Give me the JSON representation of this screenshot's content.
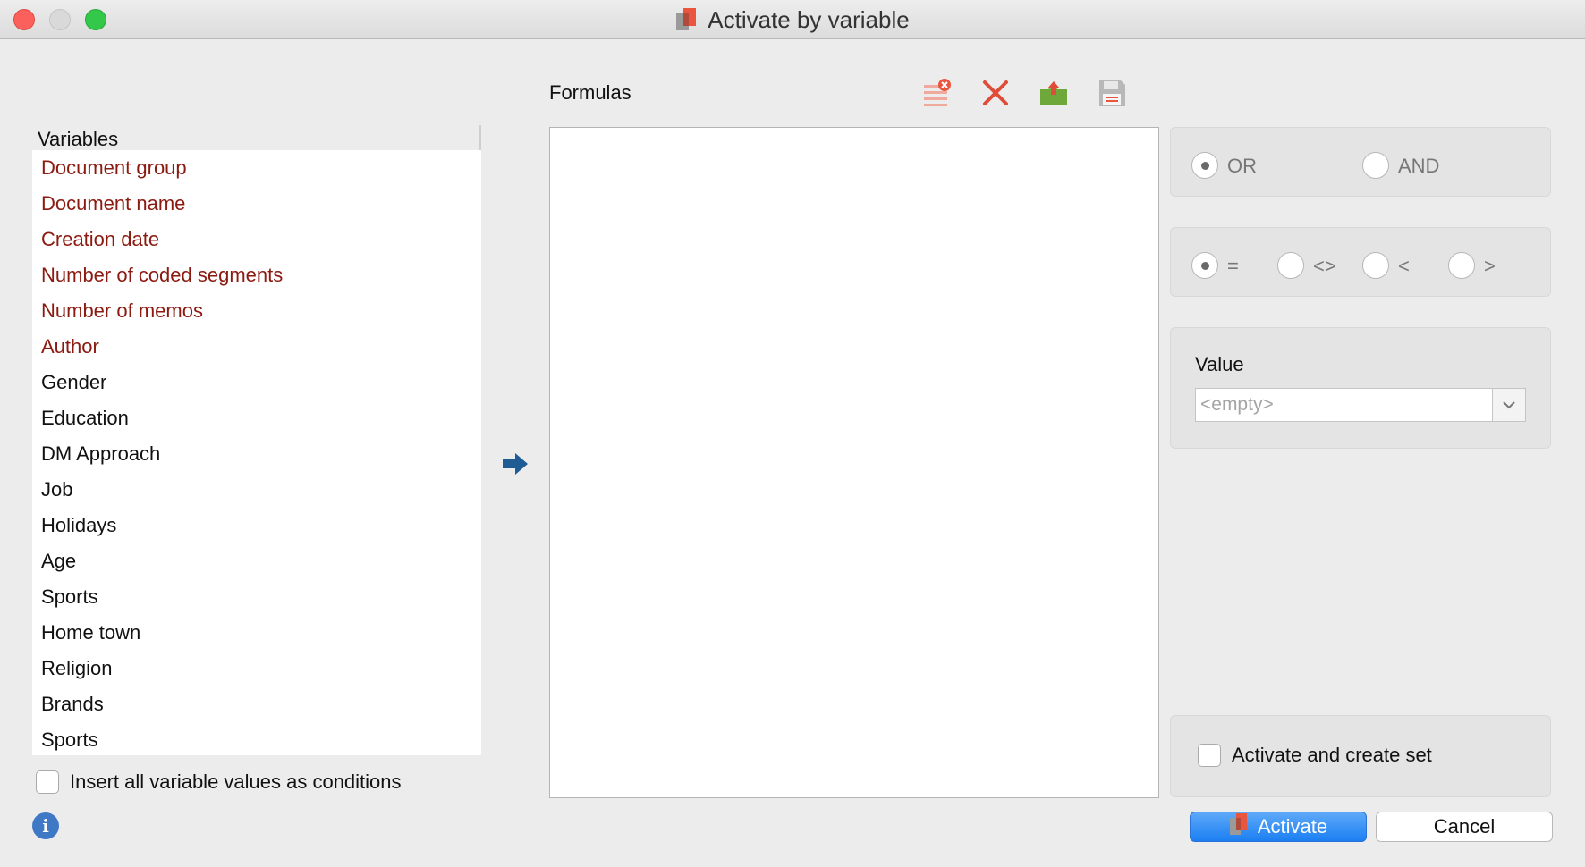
{
  "window": {
    "title": "Activate by variable",
    "title_icon": "maxqda-activate-icon"
  },
  "variables": {
    "header": "Variables",
    "items": [
      {
        "label": "Document group",
        "system": true
      },
      {
        "label": "Document name",
        "system": true
      },
      {
        "label": "Creation date",
        "system": true
      },
      {
        "label": "Number of coded segments",
        "system": true
      },
      {
        "label": "Number of memos",
        "system": true
      },
      {
        "label": "Author",
        "system": true
      },
      {
        "label": "Gender",
        "system": false
      },
      {
        "label": "Education",
        "system": false
      },
      {
        "label": "DM Approach",
        "system": false
      },
      {
        "label": "Job",
        "system": false
      },
      {
        "label": "Holidays",
        "system": false
      },
      {
        "label": "Age",
        "system": false
      },
      {
        "label": "Sports",
        "system": false
      },
      {
        "label": "Home town",
        "system": false
      },
      {
        "label": "Religion",
        "system": false
      },
      {
        "label": "Brands",
        "system": false
      },
      {
        "label": "Sports",
        "system": false
      }
    ],
    "insert_all_label": "Insert all variable values as conditions",
    "insert_all_checked": false
  },
  "formulas": {
    "label": "Formulas",
    "toolbar": [
      "clear-list-icon",
      "delete-icon",
      "open-icon",
      "save-icon"
    ]
  },
  "logic": {
    "options": [
      {
        "label": "OR",
        "selected": true
      },
      {
        "label": "AND",
        "selected": false
      }
    ]
  },
  "operators": {
    "options": [
      {
        "label": "=",
        "selected": true
      },
      {
        "label": "<>",
        "selected": false
      },
      {
        "label": "<",
        "selected": false
      },
      {
        "label": ">",
        "selected": false
      }
    ]
  },
  "value": {
    "label": "Value",
    "placeholder": "<empty>"
  },
  "activate_set": {
    "label": "Activate and create set",
    "checked": false
  },
  "buttons": {
    "activate": "Activate",
    "cancel": "Cancel"
  },
  "colors": {
    "system_variable": "#8b1a10",
    "activate_button": "#1b7ff2",
    "delete_red": "#e04c3a",
    "arrow_blue": "#1f5c93"
  }
}
